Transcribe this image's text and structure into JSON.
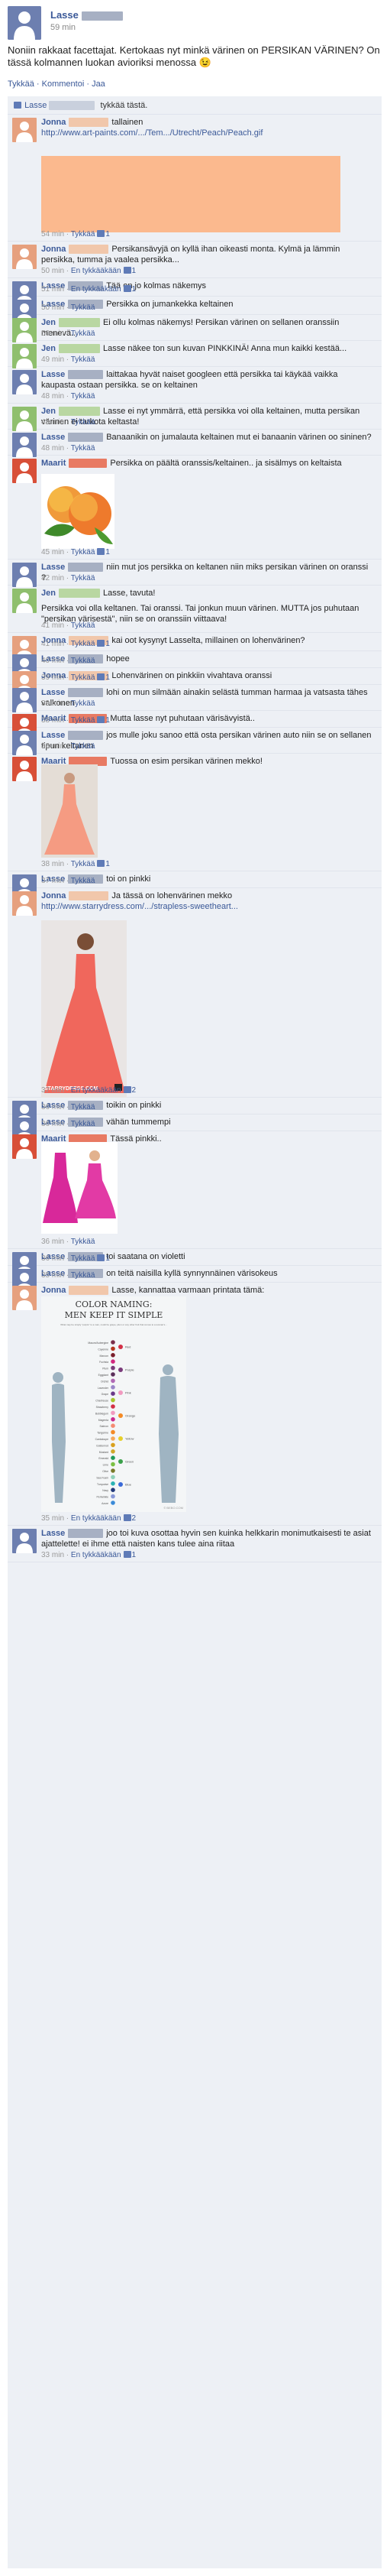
{
  "post": {
    "author": "Lasse",
    "time": "59 min",
    "text": "Noniin rakkaat facettajat. Kertokaas nyt minkä värinen on PERSIKAN VÄRINEN? On tässä kolmannen luokan avioriksi menossa",
    "emoji": "😉",
    "actions": [
      "Tykkää",
      "Kommentoi",
      "Jaa"
    ]
  },
  "likes": {
    "name": "Lasse",
    "suffix": "tykkää tästä."
  },
  "comments": [
    {
      "name": "Jonna",
      "text": "tallainen",
      "url": "http://www.art-paints.com/.../Tem.../Utrecht/Peach/Peach.gif",
      "time": "54 min",
      "actions": "Tykkää",
      "likes": "1"
    },
    {
      "name": "Jonna",
      "text": "Persikansävyjä on kyllä ihan oikeasti monta. Kylmä ja lämmin persikka, tumma ja vaalea persikka...",
      "time": "50 min",
      "actions": "En tykkääkään",
      "likes": "1"
    },
    {
      "name": "Lasse",
      "text": "Tää on jo kolmas näkemys",
      "time": "51 min",
      "actions": "En tykkääkään",
      "likes": "1"
    },
    {
      "name": "Lasse",
      "text": "Persikka on jumankekka keltainen",
      "time": "50 min",
      "actions": "Tykkää"
    },
    {
      "name": "Jen",
      "text": "Ei ollu kolmas näkemys! Persikan värinen on sellanen oranssiin menevä...",
      "time": "50 min",
      "actions": "Tykkää"
    },
    {
      "name": "Jen",
      "text": "Lasse näkee ton sun kuvan PINKKINÄ! Anna mun kaikki kestää...",
      "time": "49 min",
      "actions": "Tykkää"
    },
    {
      "name": "Lasse",
      "text": "laittakaa hyvät naiset googleen että persikka tai käykää vaikka kaupasta ostaan persikka. se on keltainen",
      "time": "48 min",
      "actions": "Tykkää"
    },
    {
      "name": "Jen",
      "text": "Lasse ei nyt ymmärrä, että persikka voi olla keltainen, mutta persikan värinen ei tarkota keltasta!",
      "time": "48 min",
      "actions": "Tykkää"
    },
    {
      "name": "Lasse",
      "text": "Banaanikin on jumalauta keltainen mut ei banaanin värinen oo sininen?",
      "time": "48 min",
      "actions": "Tykkää"
    },
    {
      "name": "Maarit",
      "text": "Persikka on päältä oranssis/keltainen.. ja sisälmys on keltaista",
      "time": "45 min",
      "actions": "Tykkää",
      "likes": "1"
    },
    {
      "name": "Lasse",
      "text": "niin mut jos persikka on keltanen niin miks persikan värinen on oranssi ?",
      "time": "42 min",
      "actions": "Tykkää"
    },
    {
      "name": "Jen",
      "text": "Lasse, tavuta!",
      "text2": "Persikka voi olla keltanen. Tai oranssi. Tai jonkun muun värinen. MUTTA jos puhutaan \"persikan värisestä\", niin se on oranssiin viittaava!",
      "time": "41 min",
      "actions": "Tykkää"
    },
    {
      "name": "Jonna",
      "text": "kai oot kysynyt Lasselta, millainen on lohenvärinen?",
      "time": "41 min",
      "actions": "Tykkää",
      "likes": "1"
    },
    {
      "name": "Lasse",
      "text": "hopee",
      "time": "40 min",
      "actions": "Tykkää"
    },
    {
      "name": "Jonna",
      "text": "Lohenvärinen on pinkkiin vivahtava oranssi",
      "time": "39 min",
      "actions": "Tykkää",
      "likes": "1"
    },
    {
      "name": "Lasse",
      "text": "lohi on mun silmään ainakin selästä tumman harmaa ja vatsasta tähes valkonen",
      "time": "39 min",
      "actions": "Tykkää"
    },
    {
      "name": "Maarit",
      "text": "Mutta lasse nyt puhutaan värisävyistä..",
      "time": "38 min",
      "actions": "Tykkää",
      "likes": "1"
    },
    {
      "name": "Lasse",
      "text": "jos mulle joku sanoo että osta persikan värinen auto niin se on sellanen tipun keltanen",
      "time": "38 min",
      "actions": "Tykkää"
    },
    {
      "name": "Maarit",
      "text": "Tuossa on esim persikan värinen mekko!",
      "time": "38 min",
      "actions": "Tykkää",
      "likes": "1"
    },
    {
      "name": "Lasse",
      "text": "toi on pinkki",
      "time": "37 min",
      "actions": "Tykkää"
    },
    {
      "name": "Jonna",
      "text": "Ja tässä on lohenvärinen mekko",
      "url": "http://www.starrydress.com/.../strapless-sweetheart...",
      "watermark": "STARRYDRESS.COM",
      "time": "37 min",
      "actions": "En tykkääkään",
      "likes": "2"
    },
    {
      "name": "Lasse",
      "text": "toikin on pinkki",
      "time": "36 min",
      "actions": "Tykkää"
    },
    {
      "name": "Lasse",
      "text": "vähän tummempi",
      "time": "36 min",
      "actions": "Tykkää"
    },
    {
      "name": "Maarit",
      "text": "Tässä pinkki..",
      "time": "36 min",
      "actions": "Tykkää"
    },
    {
      "name": "Lasse",
      "text": "toi saatana on violetti",
      "time": "36 min",
      "actions": "Tykkää",
      "likes": "1"
    },
    {
      "name": "Lasse",
      "text": "on teitä naisilla kyllä synnynnäinen värisokeus",
      "time": "35 min",
      "actions": "Tykkää"
    },
    {
      "name": "Jonna",
      "text": "Lasse, kannattaa varmaan printata tämä:",
      "time": "35 min",
      "actions": "En tykkääkään",
      "likes": "2"
    },
    {
      "name": "Lasse",
      "text": "joo toi kuva osottaa hyvin sen kuinka helkkarin monimutkaisesti te asiat ajattelette! ei ihme että naisten kans tulee aina riitaa",
      "time": "33 min",
      "actions": "En tykkääkään",
      "likes": "1"
    }
  ],
  "chart": {
    "title1": "COLOR NAMING:",
    "title2": "MEN KEEP IT SIMPLE",
    "subtitle": "What may be simply \"purple\" to a man, could be grape, plum or any other fruit that comes to a woman's...",
    "women_colors": [
      "Mauve/Aubergine",
      "Cayenne",
      "Maroon",
      "Fuchsia",
      "Plum",
      "Eggplant",
      "Orchid",
      "Lavender",
      "Grape",
      "Chartreuse",
      "Strawberry",
      "Bubblegum",
      "Magenta",
      "Salmon",
      "Tangerine",
      "Cantaloupe",
      "Goldenrod",
      "Mustard",
      "Emerald",
      "Lime",
      "Olive",
      "Sea Foam",
      "Turquoise",
      "Navy",
      "Periwinkle",
      "Azure"
    ],
    "men_colors": [
      "Red",
      "Purple",
      "Pink",
      "Orange",
      "Yellow",
      "Green",
      "Blue"
    ],
    "credit": "© BEBO.COM"
  }
}
